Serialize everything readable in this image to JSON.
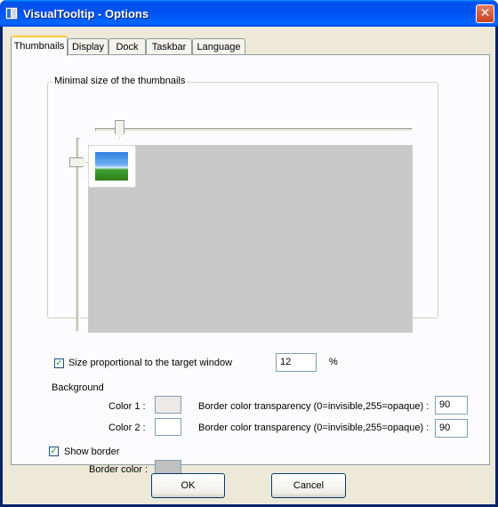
{
  "window": {
    "title": "VisualTooltip - Options",
    "close_glyph": "✕"
  },
  "tabs": [
    {
      "label": "Thumbnails",
      "active": true
    },
    {
      "label": "Display",
      "active": false
    },
    {
      "label": "Dock",
      "active": false
    },
    {
      "label": "Taskbar",
      "active": false
    },
    {
      "label": "Language",
      "active": false
    }
  ],
  "thumbnails": {
    "group_title": "Minimal size of the thumbnails",
    "size_proportional": {
      "label": "Size proportional to the target window",
      "checked": true,
      "value": "12",
      "unit": "%"
    },
    "background_label": "Background",
    "color1": {
      "label": "Color 1 :",
      "swatch": "#ece9e6",
      "transparency_label": "Border color transparency (0=invisible,255=opaque) :",
      "transparency_value": "90"
    },
    "color2": {
      "label": "Color 2 :",
      "swatch": "#ffffff",
      "transparency_label": "Border color transparency (0=invisible,255=opaque) :",
      "transparency_value": "90"
    },
    "show_border": {
      "label": "Show border",
      "checked": true
    },
    "border_color": {
      "label": "Border color :",
      "swatch": "#c0c0c0"
    }
  },
  "buttons": {
    "ok": "OK",
    "cancel": "Cancel"
  },
  "icons": {
    "app": "app-window-icon",
    "close": "close-icon",
    "check": "checkmark-icon"
  },
  "colors": {
    "titlebar": "#0054e3",
    "face": "#ece9d8",
    "panel": "#fcfcfe",
    "preview_bg": "#c8c8c8"
  }
}
